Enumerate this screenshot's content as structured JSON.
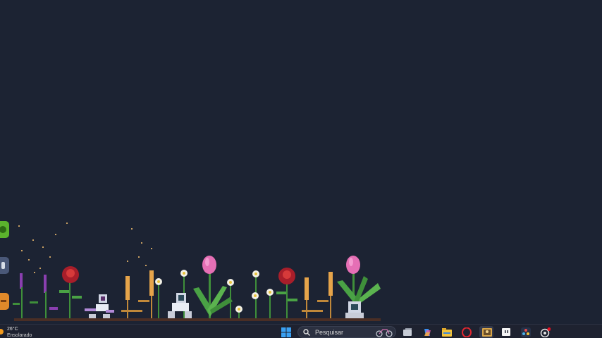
{
  "desktop": {
    "background": "#1c2333"
  },
  "side_widgets": [
    {
      "name": "green-widget",
      "color": "#5bb32d"
    },
    {
      "name": "mouse-widget",
      "color": "#4a5878"
    },
    {
      "name": "orange-widget",
      "color": "#e0892a"
    }
  ],
  "taskbar": {
    "weather": {
      "temperature": "26°C",
      "condition": "Ensolarado",
      "icon": "sun-icon"
    },
    "search": {
      "placeholder": "Pesquisar"
    },
    "apps": [
      {
        "name": "start-button",
        "icon": "windows-logo-icon"
      },
      {
        "name": "task-view",
        "icon": "task-view-icon"
      },
      {
        "name": "copilot",
        "icon": "copilot-icon"
      },
      {
        "name": "file-explorer",
        "icon": "folder-icon"
      },
      {
        "name": "opera",
        "icon": "opera-icon"
      },
      {
        "name": "photos",
        "icon": "photos-icon"
      },
      {
        "name": "twitch",
        "icon": "twitch-icon"
      },
      {
        "name": "davinci-resolve",
        "icon": "davinci-icon"
      },
      {
        "name": "chatgpt",
        "icon": "openai-icon"
      }
    ],
    "accent": "#0078d4"
  }
}
